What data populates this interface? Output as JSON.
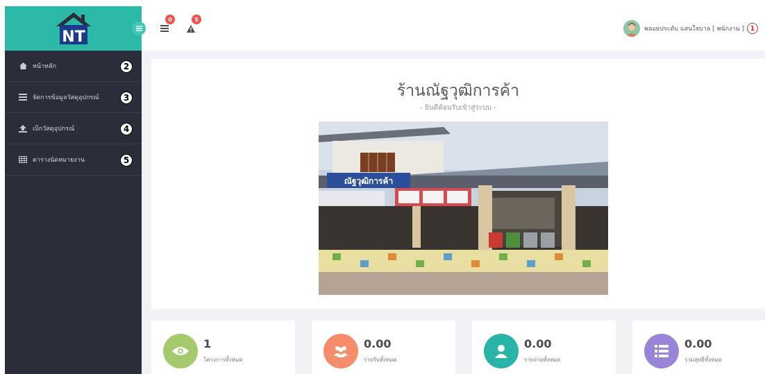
{
  "brand": {
    "logo_text": "NT",
    "logo_color": "#2cb9a8"
  },
  "header": {
    "notifications": [
      {
        "icon": "list-icon",
        "count": "0"
      },
      {
        "icon": "warning-icon",
        "count": "5"
      }
    ],
    "user": {
      "name": "พลอยประดับ แสนใจบาล [ พนักงาน ]",
      "marker": "1"
    }
  },
  "sidebar": {
    "items": [
      {
        "label": "หน้าหลัก",
        "icon": "home-icon",
        "marker": "2"
      },
      {
        "label": "จัดการข้อมูลวัสดุอุปกรณ์",
        "icon": "list-icon",
        "marker": "3"
      },
      {
        "label": "เบิกวัสดุอุปกรณ์",
        "icon": "upload-icon",
        "marker": "4"
      },
      {
        "label": "ตารางนัดหมายงาน",
        "icon": "table-icon",
        "marker": "5"
      }
    ]
  },
  "main": {
    "title": "ร้านณัฐวุฒิการค้า",
    "subtitle": "- ยินดีต้อนรับเข้าสู่ระบบ -",
    "photo_sign": "ณัฐวุฒิการค้า"
  },
  "stats": [
    {
      "value": "1",
      "label": "โครงการทั้งหมด",
      "icon": "eye-icon",
      "color": "#a5c96d"
    },
    {
      "value": "0.00",
      "label": "รายรับทั้งหมด",
      "icon": "users-icon",
      "color": "#f58d6d"
    },
    {
      "value": "0.00",
      "label": "รายจ่ายทั้งหมด",
      "icon": "user-icon",
      "color": "#2ab3a7"
    },
    {
      "value": "0.00",
      "label": "รวมสุทธิทั้งหมด",
      "icon": "list-icon",
      "color": "#9a84d8"
    }
  ]
}
